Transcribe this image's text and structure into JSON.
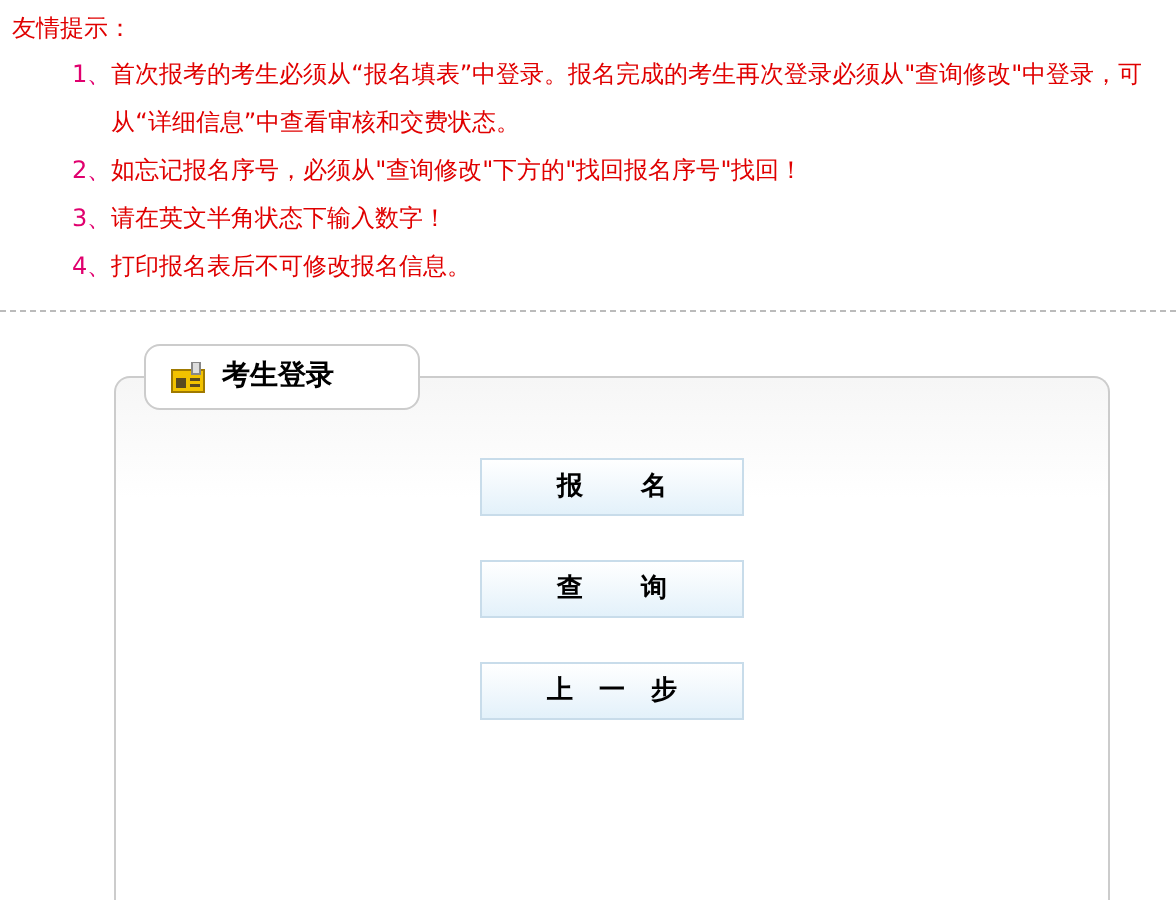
{
  "tips": {
    "title": "友情提示：",
    "items": [
      {
        "number": "1、",
        "text": "首次报考的考生必须从“报名填表”中登录。报名完成的考生再次登录必须从\"查询修改\"中登录，可从“详细信息”中查看审核和交费状态。"
      },
      {
        "number": "2、",
        "text": "如忘记报名序号，必须从\"查询修改\"下方的\"找回报名序号\"找回！"
      },
      {
        "number": "3、",
        "text": "请在英文半角状态下输入数字！"
      },
      {
        "number": "4、",
        "text": "打印报名表后不可修改报名信息。"
      }
    ]
  },
  "login_panel": {
    "title": "考生登录",
    "buttons": [
      "报名",
      "查询",
      "上一步"
    ]
  }
}
